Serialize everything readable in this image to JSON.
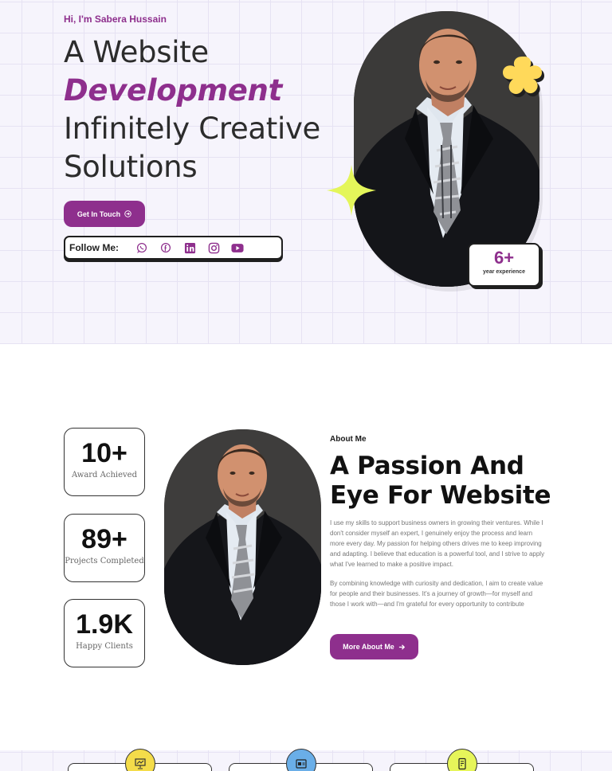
{
  "hero": {
    "greeting": "Hi, I'm Sabera Hussain",
    "line1": "A Website",
    "line2": "Development",
    "line3": "Infinitely Creative",
    "line4": "Solutions",
    "cta_label": "Get In Touch",
    "follow_label": "Follow Me:",
    "social_icons": [
      "whatsapp-icon",
      "facebook-icon",
      "linkedin-icon",
      "instagram-icon",
      "youtube-icon"
    ],
    "experience_value": "6+",
    "experience_label": "year experience"
  },
  "about": {
    "stats": [
      {
        "value": "10+",
        "label": "Award Achieved"
      },
      {
        "value": "89+",
        "label": "Projects Completed"
      },
      {
        "value": "1.9K",
        "label": "Happy Clients"
      }
    ],
    "kicker": "About Me",
    "title_line1": "A Passion And",
    "title_line2": "Eye For Website",
    "paragraph1": "I use my skills to support business owners in growing their ventures. While I don't consider myself an expert, I genuinely enjoy the process and learn more every day. My passion for helping others drives me to keep improving and adapting. I believe that education is a powerful tool, and I strive to apply what I've learned to make a positive impact.",
    "paragraph2": "By combining knowledge with curiosity and dedication, I aim to create value for people and their businesses. It's a journey of growth—for myself and those I work with—and I'm grateful for every opportunity to contribute",
    "cta_label": "More About Me"
  },
  "services": {
    "icons": [
      "presentation-icon",
      "browser-card-icon",
      "mobile-app-icon"
    ],
    "icon_colors": [
      "#f4dc4a",
      "#6aaee8",
      "#e6f55a"
    ]
  },
  "colors": {
    "accent": "#8e2f8d",
    "flower": "#ffd95a",
    "spark": "#e4f65a",
    "grid_bg": "#f6f4fc"
  }
}
